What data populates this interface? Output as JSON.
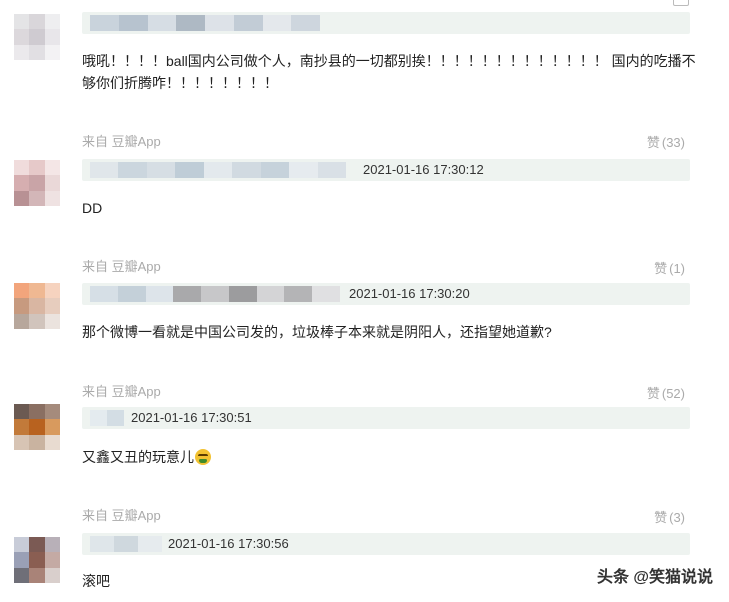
{
  "colors": {
    "header_bg": "#eef3f0",
    "muted": "#aaaaaa",
    "text": "#222222"
  },
  "comments": [
    {
      "timestamp": "",
      "text": "哦吼！！！！ball国内公司做个人，南抄县的一切都别挨！！！！！！！！！！！！！ 国内的吃播不够你们折腾咋！！！！！！！！",
      "source": "来自 豆瓣App",
      "likes_label": "赞",
      "likes_count": "(33)"
    },
    {
      "timestamp": "2021-01-16 17:30:12",
      "text": "DD",
      "source": "来自 豆瓣App",
      "likes_label": "赞",
      "likes_count": "(1)"
    },
    {
      "timestamp": "2021-01-16 17:30:20",
      "text": "那个微博一看就是中国公司发的，垃圾棒子本来就是阴阳人，还指望她道歉?",
      "source": "来自 豆瓣App",
      "likes_label": "赞",
      "likes_count": "(52)"
    },
    {
      "timestamp": "2021-01-16 17:30:51",
      "text": "又鑫又丑的玩意儿",
      "source": "来自 豆瓣App",
      "likes_label": "赞",
      "likes_count": "(3)"
    },
    {
      "timestamp": "2021-01-16 17:30:56",
      "text": "滚吧",
      "source": "",
      "likes_label": "",
      "likes_count": ""
    }
  ],
  "watermark": "头条 @笑猫说说"
}
